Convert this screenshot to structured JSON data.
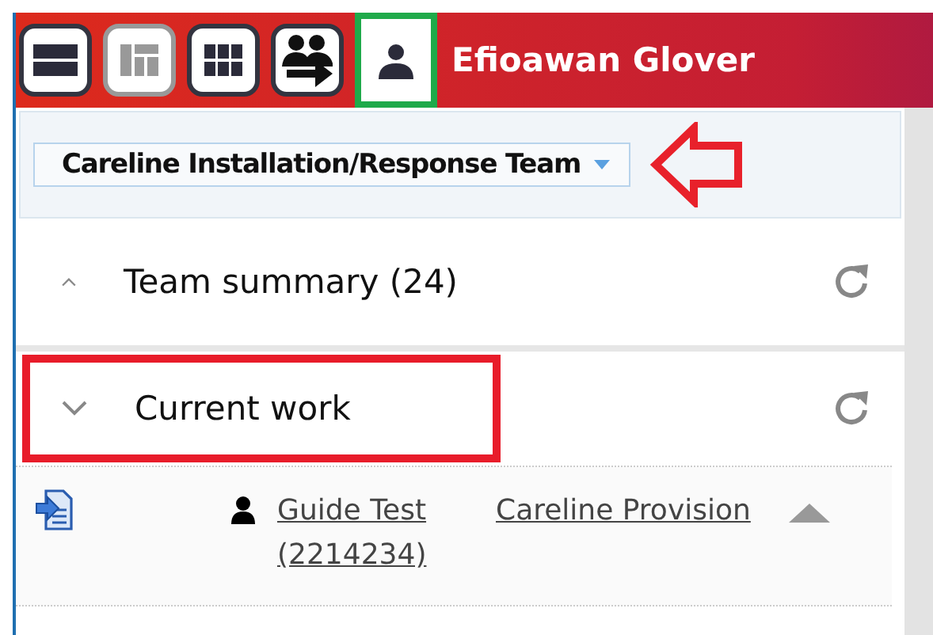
{
  "header": {
    "tools": [
      {
        "kind": "rows",
        "disabled": false,
        "highlighted": false
      },
      {
        "kind": "layout",
        "disabled": true,
        "highlighted": false
      },
      {
        "kind": "grid",
        "disabled": false,
        "highlighted": false
      },
      {
        "kind": "transfer",
        "disabled": false,
        "highlighted": false
      },
      {
        "kind": "person",
        "disabled": false,
        "highlighted": true
      }
    ],
    "user_name": "Efioawan Glover"
  },
  "team_select": {
    "value": "Careline Installation/Response Team",
    "pointed": true
  },
  "sections": [
    {
      "title": "Team summary (24)",
      "expanded": false,
      "outlined": false
    },
    {
      "title": "Current work",
      "expanded": true,
      "outlined": true
    }
  ],
  "work_items": [
    {
      "person": "Guide Test (2214234)",
      "service": "Careline Provision"
    }
  ]
}
